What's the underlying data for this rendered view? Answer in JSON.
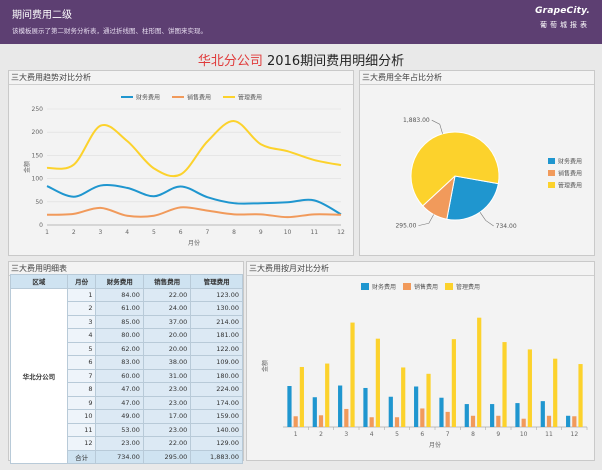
{
  "header": {
    "title": "期间费用二级",
    "desc": "该模板展示了第二财务分析表，通过折线图、柱形图、饼图来实现。",
    "brand": "GrapeCity.",
    "brand_sub": "葡萄城报表"
  },
  "page_title": {
    "company": "华北分公司",
    "rest": " 2016期间费用明细分析"
  },
  "panels": {
    "trend": "三大费用趋势对比分析",
    "pie": "三大费用全年占比分析",
    "table": "三大费用明细表",
    "monthly": "三大费用按月对比分析"
  },
  "colors": {
    "finance": "#1f96cf",
    "sales": "#f19a5b",
    "mgmt": "#fcd22c"
  },
  "table": {
    "headers": [
      "区域",
      "月份",
      "财务费用",
      "销售费用",
      "管理费用"
    ],
    "region": "华北分公司",
    "rows": [
      [
        "1",
        "84.00",
        "22.00",
        "123.00"
      ],
      [
        "2",
        "61.00",
        "24.00",
        "130.00"
      ],
      [
        "3",
        "85.00",
        "37.00",
        "214.00"
      ],
      [
        "4",
        "80.00",
        "20.00",
        "181.00"
      ],
      [
        "5",
        "62.00",
        "20.00",
        "122.00"
      ],
      [
        "6",
        "83.00",
        "38.00",
        "109.00"
      ],
      [
        "7",
        "60.00",
        "31.00",
        "180.00"
      ],
      [
        "8",
        "47.00",
        "23.00",
        "224.00"
      ],
      [
        "9",
        "47.00",
        "23.00",
        "174.00"
      ],
      [
        "10",
        "49.00",
        "17.00",
        "159.00"
      ],
      [
        "11",
        "53.00",
        "23.00",
        "140.00"
      ],
      [
        "12",
        "23.00",
        "22.00",
        "129.00"
      ]
    ],
    "total": [
      "合计",
      "734.00",
      "295.00",
      "1,883.00"
    ]
  },
  "chart_data": [
    {
      "type": "line",
      "xlabel": "月份",
      "ylabel": "金额",
      "ylim": [
        0,
        250
      ],
      "yticks": [
        0,
        50,
        100,
        150,
        200,
        250
      ],
      "categories": [
        "1",
        "2",
        "3",
        "4",
        "5",
        "6",
        "7",
        "8",
        "9",
        "10",
        "11",
        "12"
      ],
      "legend": "top",
      "series": [
        {
          "name": "财务费用",
          "values": [
            84,
            61,
            85,
            80,
            62,
            83,
            60,
            47,
            47,
            49,
            53,
            23
          ]
        },
        {
          "name": "销售费用",
          "values": [
            22,
            24,
            37,
            20,
            20,
            38,
            31,
            23,
            23,
            17,
            23,
            22
          ]
        },
        {
          "name": "管理费用",
          "values": [
            123,
            130,
            214,
            181,
            122,
            109,
            180,
            224,
            174,
            159,
            140,
            129
          ]
        }
      ]
    },
    {
      "type": "pie",
      "legend": "right",
      "slices": [
        {
          "name": "财务费用",
          "value": 734,
          "label": "734.00"
        },
        {
          "name": "销售费用",
          "value": 295,
          "label": "295.00"
        },
        {
          "name": "管理费用",
          "value": 1883,
          "label": "1,883.00"
        }
      ]
    },
    {
      "type": "bar",
      "xlabel": "月份",
      "ylabel": "金额",
      "ylim": [
        0,
        250
      ],
      "categories": [
        "1",
        "2",
        "3",
        "4",
        "5",
        "6",
        "7",
        "8",
        "9",
        "10",
        "11",
        "12"
      ],
      "legend": "top",
      "series": [
        {
          "name": "财务费用",
          "values": [
            84,
            61,
            85,
            80,
            62,
            83,
            60,
            47,
            47,
            49,
            53,
            23
          ]
        },
        {
          "name": "销售费用",
          "values": [
            22,
            24,
            37,
            20,
            20,
            38,
            31,
            23,
            23,
            17,
            23,
            22
          ]
        },
        {
          "name": "管理费用",
          "values": [
            123,
            130,
            214,
            181,
            122,
            109,
            180,
            224,
            174,
            159,
            140,
            129
          ]
        }
      ]
    }
  ]
}
